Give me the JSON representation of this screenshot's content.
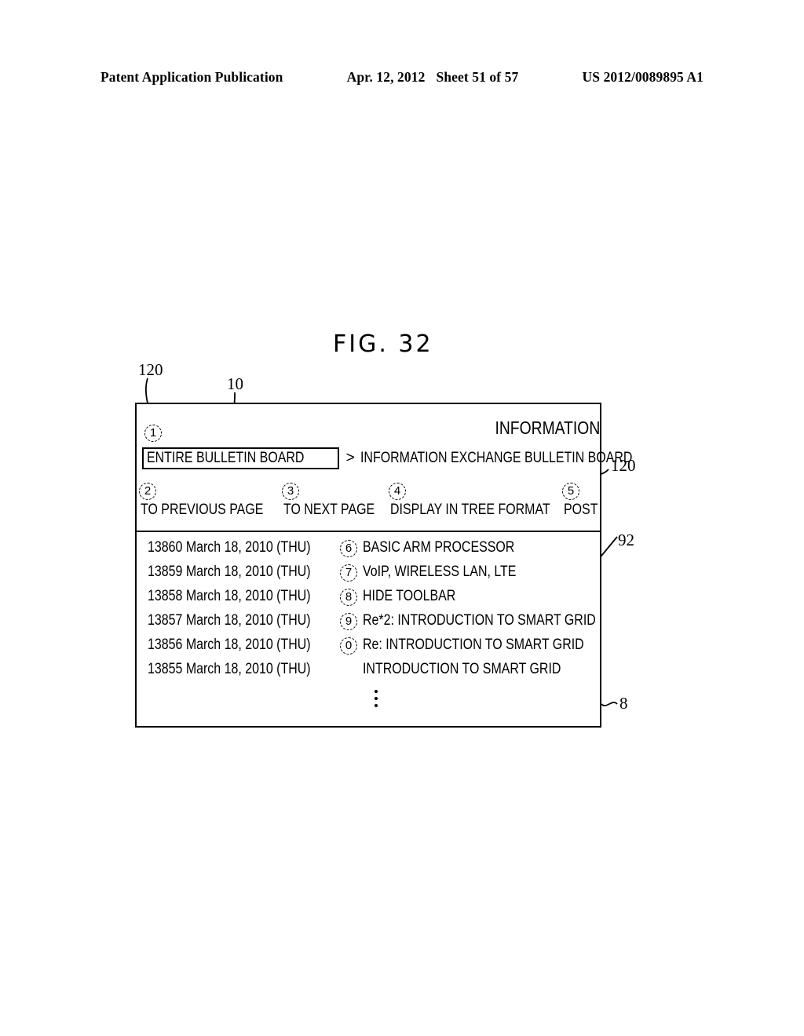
{
  "page_header": {
    "publication": "Patent Application Publication",
    "date": "Apr. 12, 2012",
    "sheet": "Sheet 51 of 57",
    "patent_number": "US 2012/0089895 A1"
  },
  "figure": {
    "title": "FIG. 32",
    "reference_numerals": {
      "frame_top_left": "120",
      "breadcrumb_callout": "10",
      "toolbar_right": "120",
      "list_area": "92",
      "device": "8"
    }
  },
  "screen": {
    "title": "INFORMATION",
    "breadcrumb": {
      "marker": "1",
      "current": "ENTIRE BULLETIN BOARD",
      "separator": ">",
      "parent": "INFORMATION EXCHANGE BULLETIN BOARD"
    },
    "toolbar": [
      {
        "marker": "2",
        "label": "TO PREVIOUS PAGE"
      },
      {
        "marker": "3",
        "label": "TO NEXT PAGE"
      },
      {
        "marker": "4",
        "label": "DISPLAY IN TREE FORMAT"
      },
      {
        "marker": "5",
        "label": "POST"
      }
    ],
    "messages": [
      {
        "id": "13860",
        "date": "March 18, 2010 (THU)",
        "marker": "6",
        "subject": "BASIC ARM PROCESSOR"
      },
      {
        "id": "13859",
        "date": "March 18, 2010 (THU)",
        "marker": "7",
        "subject": "VoIP, WIRELESS LAN, LTE"
      },
      {
        "id": "13858",
        "date": "March 18, 2010 (THU)",
        "marker": "8",
        "subject": "HIDE TOOLBAR"
      },
      {
        "id": "13857",
        "date": "March 18, 2010 (THU)",
        "marker": "9",
        "subject": "Re*2: INTRODUCTION TO SMART GRID"
      },
      {
        "id": "13856",
        "date": "March 18, 2010 (THU)",
        "marker": "0",
        "subject": "Re: INTRODUCTION TO SMART GRID"
      },
      {
        "id": "13855",
        "date": "March 18, 2010 (THU)",
        "marker": "",
        "subject": "INTRODUCTION TO SMART GRID"
      }
    ],
    "more_indicator": "vertical-ellipsis"
  }
}
